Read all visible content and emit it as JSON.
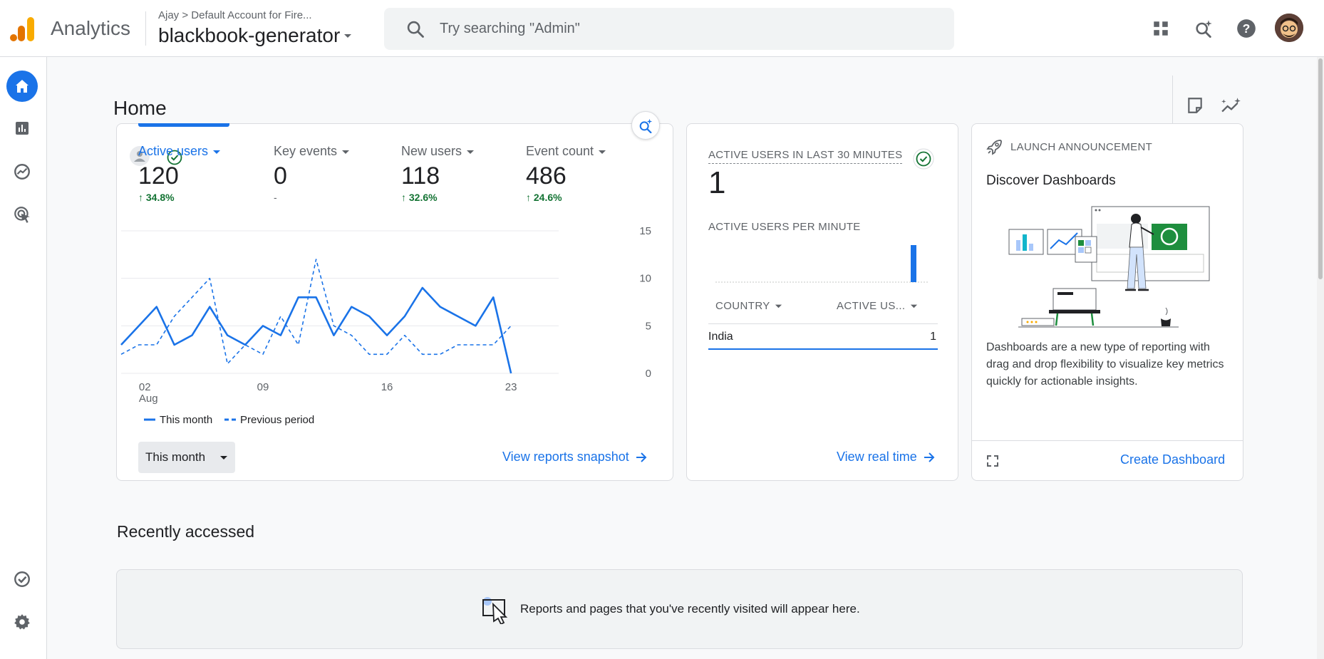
{
  "header": {
    "app_name": "Analytics",
    "breadcrumb_account": "Ajay",
    "breadcrumb_sep": ">",
    "breadcrumb_default": "Default Account for Fire...",
    "property": "blackbook-generator",
    "search_placeholder": "Try searching \"Admin\""
  },
  "page": {
    "title": "Home"
  },
  "metrics": [
    {
      "label": "Active users",
      "value": "120",
      "delta": "34.8%",
      "up": true
    },
    {
      "label": "Key events",
      "value": "0",
      "delta": "-",
      "up": false
    },
    {
      "label": "New users",
      "value": "118",
      "delta": "32.6%",
      "up": true
    },
    {
      "label": "Event count",
      "value": "486",
      "delta": "24.6%",
      "up": true
    }
  ],
  "chart_data": {
    "type": "line",
    "x_tick_labels": [
      "02",
      "09",
      "16",
      "23"
    ],
    "x_sub_label": "Aug",
    "y_tick_labels": [
      "15",
      "10",
      "5",
      "0"
    ],
    "ylim": [
      0,
      15
    ],
    "x_days": [
      1,
      2,
      3,
      4,
      5,
      6,
      7,
      8,
      9,
      10,
      11,
      12,
      13,
      14,
      15,
      16,
      17,
      18,
      19,
      20,
      21,
      22,
      23,
      24
    ],
    "series": [
      {
        "name": "This month",
        "style": "solid",
        "color": "#1a73e8",
        "values": [
          3,
          5,
          7,
          3,
          4,
          7,
          4,
          3,
          5,
          4,
          8,
          8,
          4,
          7,
          6,
          4,
          6,
          9,
          7,
          6,
          5,
          8,
          0,
          null
        ]
      },
      {
        "name": "Previous period",
        "style": "dashed",
        "color": "#1a73e8",
        "values": [
          2,
          3,
          3,
          6,
          8,
          10,
          1,
          3,
          2,
          6,
          3,
          12,
          5,
          4,
          2,
          2,
          4,
          2,
          2,
          3,
          3,
          3,
          5,
          null
        ]
      }
    ],
    "grid": true,
    "legend": "bottom-left"
  },
  "date_range": {
    "label": "This month"
  },
  "links": {
    "view_reports": "View reports snapshot",
    "view_realtime": "View real time",
    "create_dashboard": "Create Dashboard"
  },
  "realtime": {
    "title": "ACTIVE USERS IN LAST 30 MINUTES",
    "value": "1",
    "per_minute_title": "ACTIVE USERS PER MINUTE",
    "col_country": "COUNTRY",
    "col_active": "ACTIVE US...",
    "rows": [
      {
        "country": "India",
        "value": "1"
      }
    ]
  },
  "launch": {
    "label": "LAUNCH ANNOUNCEMENT",
    "title": "Discover Dashboards",
    "body": "Dashboards are a new type of reporting with drag and drop flexibility to visualize key metrics quickly for actionable insights."
  },
  "recent": {
    "title": "Recently accessed",
    "empty_text": "Reports and pages that you've recently visited will appear here."
  },
  "colors": {
    "accent": "#1a73e8",
    "positive": "#137333",
    "logo_orange": "#f9ab00",
    "logo_dark": "#e37400"
  }
}
